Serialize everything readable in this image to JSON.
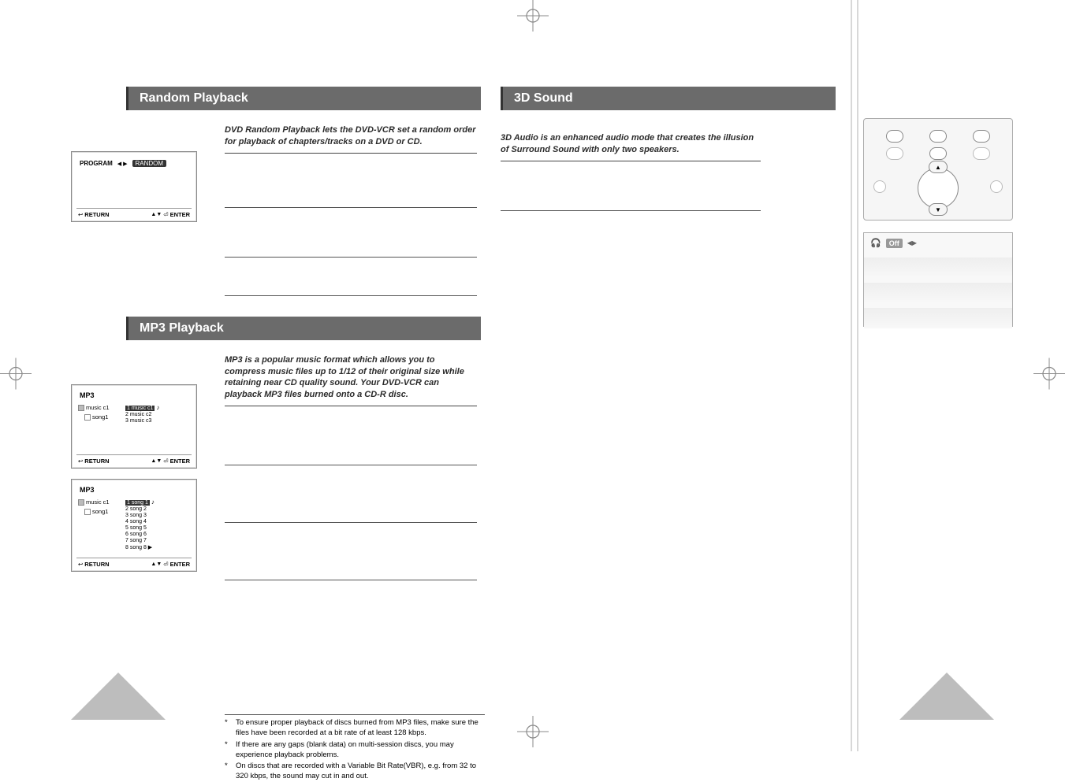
{
  "sections": {
    "random": {
      "title": "Random Playback",
      "intro": "DVD Random Playback lets the DVD-VCR set a random order for playback of chapters/tracks on a DVD or CD."
    },
    "mp3": {
      "title": "MP3 Playback",
      "intro": "MP3 is a popular music format which allows you to compress music files up to 1/12 of their original size while retaining near CD quality sound. Your DVD-VCR can playback MP3 files burned onto a CD-R disc."
    },
    "sound3d": {
      "title": "3D Sound",
      "intro": "3D Audio is an enhanced audio mode that creates the illusion of Surround Sound with only two speakers."
    }
  },
  "osd": {
    "program": {
      "program_label": "PROGRAM",
      "lr": "◀ ▶",
      "random_label": "RANDOM",
      "return_label": "RETURN",
      "nav": "▲▼",
      "enter_label": "ENTER"
    },
    "mp3a": {
      "title": "MP3",
      "tree": {
        "folder": "music c1",
        "file": "song1"
      },
      "list": [
        "1 music c1",
        "2 music c2",
        "3 music c3"
      ],
      "return_label": "RETURN",
      "nav": "▲▼",
      "enter_label": "ENTER"
    },
    "mp3b": {
      "title": "MP3",
      "tree": {
        "folder": "music c1",
        "file": "song1"
      },
      "list": [
        "1 song 1",
        "2 song 2",
        "3 song 3",
        "4 song 4",
        "5 song 5",
        "6 song 6",
        "7 song 7",
        "8 song 8 ▶"
      ],
      "return_label": "RETURN",
      "nav": "▲▼",
      "enter_label": "ENTER"
    }
  },
  "status_panel": {
    "off_label": "Off",
    "arrows": "◀▶"
  },
  "remote": {
    "up": "▲",
    "down": "▼"
  },
  "footnotes": {
    "f1": "To ensure proper playback of discs burned from MP3 files, make sure the files have been recorded at a bit rate of at least 128 kbps.",
    "f2": "If there are any gaps (blank data) on multi-session discs, you may experience playback problems.",
    "f3": "On discs that are recorded with a Variable Bit Rate(VBR), e.g. from 32 to 320 kbps, the sound may cut in and out."
  },
  "icons": {
    "note": "♪",
    "enter_box": "⏎",
    "return_box": "↩"
  }
}
